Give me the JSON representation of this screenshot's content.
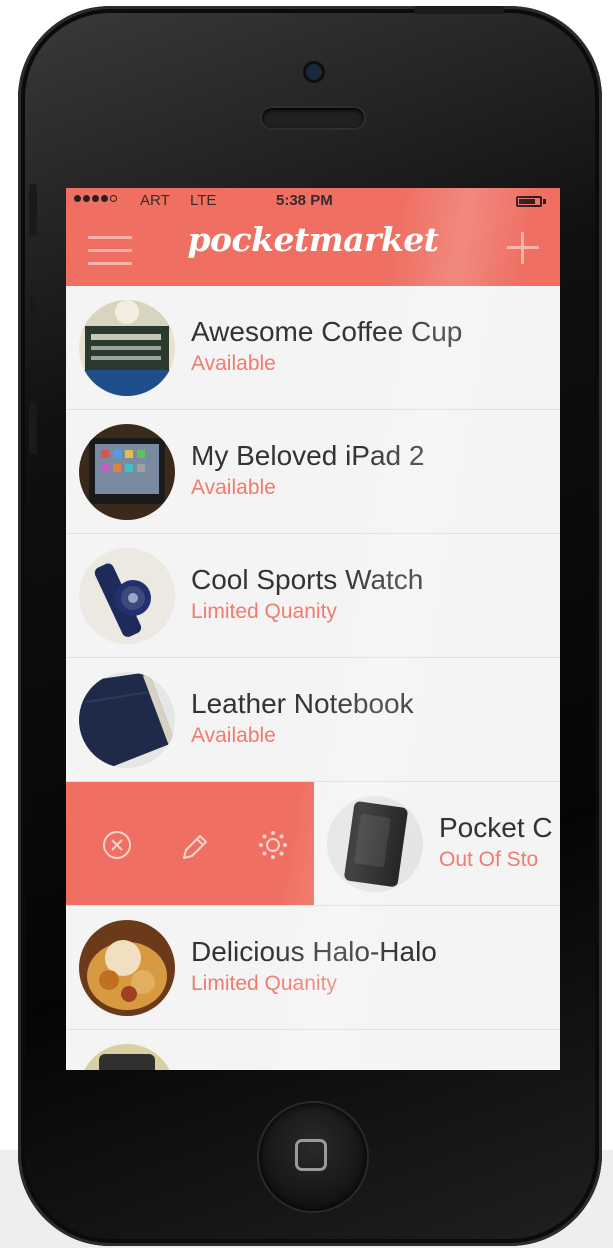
{
  "status_bar": {
    "carrier": "ART",
    "network": "LTE",
    "time": "5:38 PM"
  },
  "header": {
    "app_name": "pocketmarket",
    "menu_icon": "hamburger-menu-icon",
    "add_icon": "plus-icon",
    "accent_color": "#ef6f62"
  },
  "items": [
    {
      "title": "Awesome Coffee Cup",
      "status": "Available"
    },
    {
      "title": "My Beloved iPad 2",
      "status": "Available"
    },
    {
      "title": "Cool Sports Watch",
      "status": "Limited Quanity"
    },
    {
      "title": "Leather Notebook",
      "status": "Available"
    },
    {
      "title": "Pocket C",
      "status": "Out Of Sto"
    },
    {
      "title": "Delicious Halo-Halo",
      "status": "Limited Quanity"
    }
  ],
  "swipe_actions": {
    "delete_icon": "close-circle-icon",
    "edit_icon": "pencil-icon",
    "settings_icon": "gear-icon"
  }
}
